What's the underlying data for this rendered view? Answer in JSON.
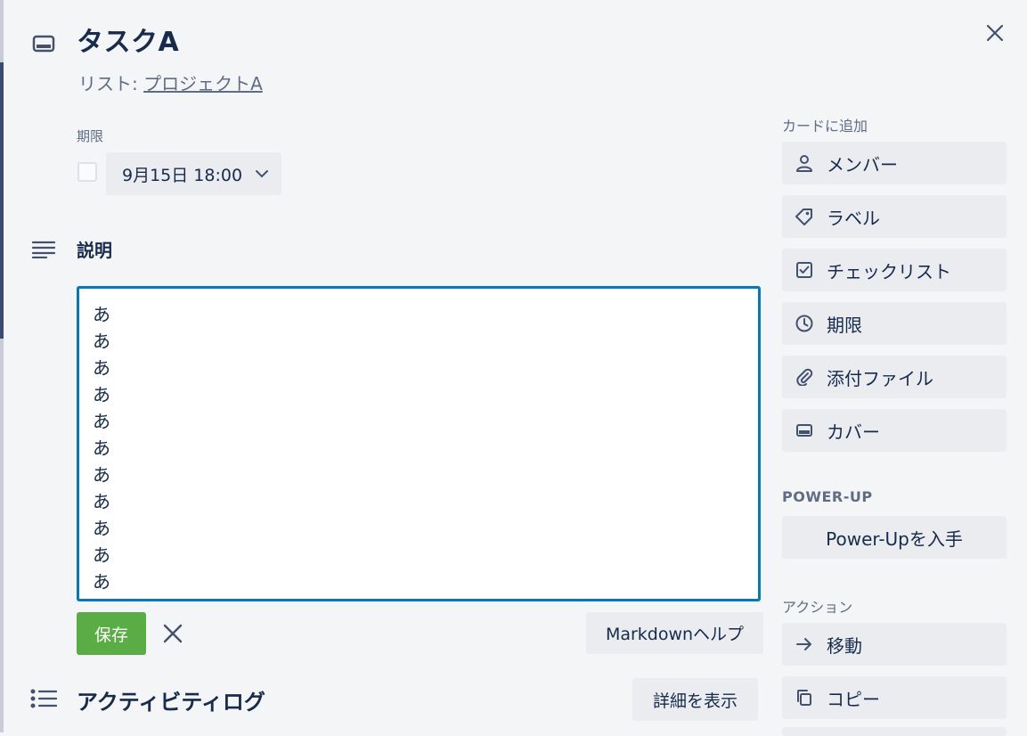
{
  "card": {
    "title": "タスクA",
    "list_prefix": "リスト: ",
    "list_name": "プロジェクトA"
  },
  "due": {
    "label": "期限",
    "date_text": "9月15日 18:00"
  },
  "description": {
    "heading": "説明",
    "lines": [
      "あ",
      "あ",
      "あ",
      "あ",
      "あ",
      "あ",
      "あ",
      "あ",
      "あ",
      "あ",
      "あ"
    ],
    "save_label": "保存",
    "markdown_help_label": "Markdownヘルプ"
  },
  "activity": {
    "heading": "アクティビティログ",
    "show_details_label": "詳細を表示"
  },
  "sidebar": {
    "add_to_card_label": "カードに追加",
    "add_items": [
      {
        "label": "メンバー",
        "icon": "person-icon"
      },
      {
        "label": "ラベル",
        "icon": "tag-icon"
      },
      {
        "label": "チェックリスト",
        "icon": "checklist-icon"
      },
      {
        "label": "期限",
        "icon": "clock-icon"
      },
      {
        "label": "添付ファイル",
        "icon": "paperclip-icon"
      },
      {
        "label": "カバー",
        "icon": "cover-icon"
      }
    ],
    "powerup_label": "POWER-UP",
    "powerup_button": "Power-Upを入手",
    "actions_label": "アクション",
    "action_items": [
      {
        "label": "移動",
        "icon": "arrow-right-icon"
      },
      {
        "label": "コピー",
        "icon": "copy-icon"
      }
    ]
  },
  "colors": {
    "accent": "#0079bf",
    "save": "#5aac44",
    "background": "#f4f5f7",
    "button": "#eaecf0",
    "text": "#172b4d",
    "muted": "#5e6c84"
  }
}
